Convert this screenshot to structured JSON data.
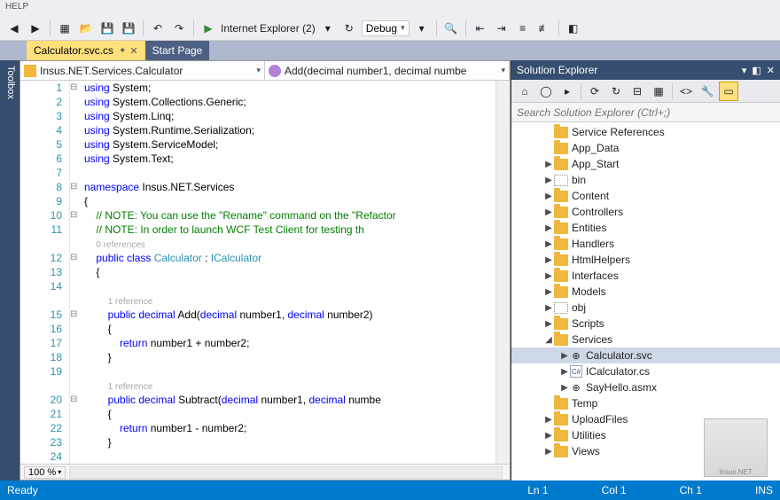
{
  "menu": {
    "help": "HELP"
  },
  "toolbar": {
    "run_label": "Internet Explorer (2)",
    "config": "Debug"
  },
  "tabs": {
    "active": "Calculator.svc.cs",
    "other": "Start Page"
  },
  "navbar": {
    "class": "Insus.NET.Services.Calculator",
    "member": "Add(decimal number1, decimal numbe"
  },
  "code": {
    "lines": [
      {
        "n": 1,
        "fold": "⊟",
        "html": "<span class='kw'>using</span> System;"
      },
      {
        "n": 2,
        "fold": "",
        "html": "<span class='kw'>using</span> System.Collections.Generic;"
      },
      {
        "n": 3,
        "fold": "",
        "html": "<span class='kw'>using</span> System.Linq;"
      },
      {
        "n": 4,
        "fold": "",
        "html": "<span class='kw'>using</span> System.Runtime.Serialization;"
      },
      {
        "n": 5,
        "fold": "",
        "html": "<span class='kw'>using</span> System.ServiceModel;"
      },
      {
        "n": 6,
        "fold": "",
        "html": "<span class='kw'>using</span> System.Text;"
      },
      {
        "n": 7,
        "fold": "",
        "html": ""
      },
      {
        "n": 8,
        "fold": "⊟",
        "html": "<span class='kw'>namespace</span> Insus.NET.Services"
      },
      {
        "n": 9,
        "fold": "",
        "html": "{"
      },
      {
        "n": 10,
        "fold": "⊟",
        "html": "    <span class='cm'>// NOTE: You can use the \"Rename\" command on the \"Refactor</span>"
      },
      {
        "n": 11,
        "fold": "",
        "html": "    <span class='cm'>// NOTE: In order to launch WCF Test Client for testing th</span>"
      },
      {
        "n": "",
        "fold": "",
        "html": "    <span class='ref'>0 references</span>"
      },
      {
        "n": 12,
        "fold": "⊟",
        "html": "    <span class='kw'>public</span> <span class='kw'>class</span> <span class='ty'>Calculator</span> : <span class='ty'>ICalculator</span>"
      },
      {
        "n": 13,
        "fold": "",
        "html": "    {"
      },
      {
        "n": 14,
        "fold": "",
        "html": ""
      },
      {
        "n": "",
        "fold": "",
        "html": "        <span class='ref'>1 reference</span>"
      },
      {
        "n": 15,
        "fold": "⊟",
        "html": "        <span class='kw'>public</span> <span class='kw'>decimal</span> Add(<span class='kw'>decimal</span> number1, <span class='kw'>decimal</span> number2)"
      },
      {
        "n": 16,
        "fold": "",
        "html": "        {"
      },
      {
        "n": 17,
        "fold": "",
        "html": "            <span class='kw'>return</span> number1 + number2;"
      },
      {
        "n": 18,
        "fold": "",
        "html": "        }"
      },
      {
        "n": 19,
        "fold": "",
        "html": ""
      },
      {
        "n": "",
        "fold": "",
        "html": "        <span class='ref'>1 reference</span>"
      },
      {
        "n": 20,
        "fold": "⊟",
        "html": "        <span class='kw'>public</span> <span class='kw'>decimal</span> Subtract(<span class='kw'>decimal</span> number1, <span class='kw'>decimal</span> numbe"
      },
      {
        "n": 21,
        "fold": "",
        "html": "        {"
      },
      {
        "n": 22,
        "fold": "",
        "html": "            <span class='kw'>return</span> number1 - number2;"
      },
      {
        "n": 23,
        "fold": "",
        "html": "        }"
      },
      {
        "n": 24,
        "fold": "",
        "html": ""
      }
    ]
  },
  "zoom": "100 %",
  "sln": {
    "title": "Solution Explorer",
    "search_placeholder": "Search Solution Explorer (Ctrl+;)",
    "items": [
      {
        "depth": 2,
        "exp": "",
        "kind": "folder",
        "label": "Service References"
      },
      {
        "depth": 2,
        "exp": "",
        "kind": "folder",
        "label": "App_Data"
      },
      {
        "depth": 2,
        "exp": "▶",
        "kind": "folder",
        "label": "App_Start"
      },
      {
        "depth": 2,
        "exp": "▶",
        "kind": "dotted",
        "label": "bin"
      },
      {
        "depth": 2,
        "exp": "▶",
        "kind": "folder",
        "label": "Content"
      },
      {
        "depth": 2,
        "exp": "▶",
        "kind": "folder",
        "label": "Controllers"
      },
      {
        "depth": 2,
        "exp": "▶",
        "kind": "folder",
        "label": "Entities"
      },
      {
        "depth": 2,
        "exp": "▶",
        "kind": "folder",
        "label": "Handlers"
      },
      {
        "depth": 2,
        "exp": "▶",
        "kind": "folder",
        "label": "HtmlHelpers"
      },
      {
        "depth": 2,
        "exp": "▶",
        "kind": "folder",
        "label": "Interfaces"
      },
      {
        "depth": 2,
        "exp": "▶",
        "kind": "folder",
        "label": "Models"
      },
      {
        "depth": 2,
        "exp": "▶",
        "kind": "dotted",
        "label": "obj"
      },
      {
        "depth": 2,
        "exp": "▶",
        "kind": "folder",
        "label": "Scripts"
      },
      {
        "depth": 2,
        "exp": "◢",
        "kind": "folder",
        "label": "Services"
      },
      {
        "depth": 3,
        "exp": "▶",
        "kind": "svc",
        "label": "Calculator.svc",
        "sel": true
      },
      {
        "depth": 3,
        "exp": "▶",
        "kind": "cs",
        "label": "ICalculator.cs"
      },
      {
        "depth": 3,
        "exp": "▶",
        "kind": "asmx",
        "label": "SayHello.asmx"
      },
      {
        "depth": 2,
        "exp": "",
        "kind": "folder",
        "label": "Temp"
      },
      {
        "depth": 2,
        "exp": "▶",
        "kind": "folder",
        "label": "UploadFiles"
      },
      {
        "depth": 2,
        "exp": "▶",
        "kind": "folder",
        "label": "Utilities"
      },
      {
        "depth": 2,
        "exp": "▶",
        "kind": "folder",
        "label": "Views"
      }
    ]
  },
  "status": {
    "ready": "Ready",
    "ln": "Ln 1",
    "col": "Col 1",
    "ch": "Ch 1",
    "ins": "INS"
  },
  "toolbox_label": "Toolbox"
}
